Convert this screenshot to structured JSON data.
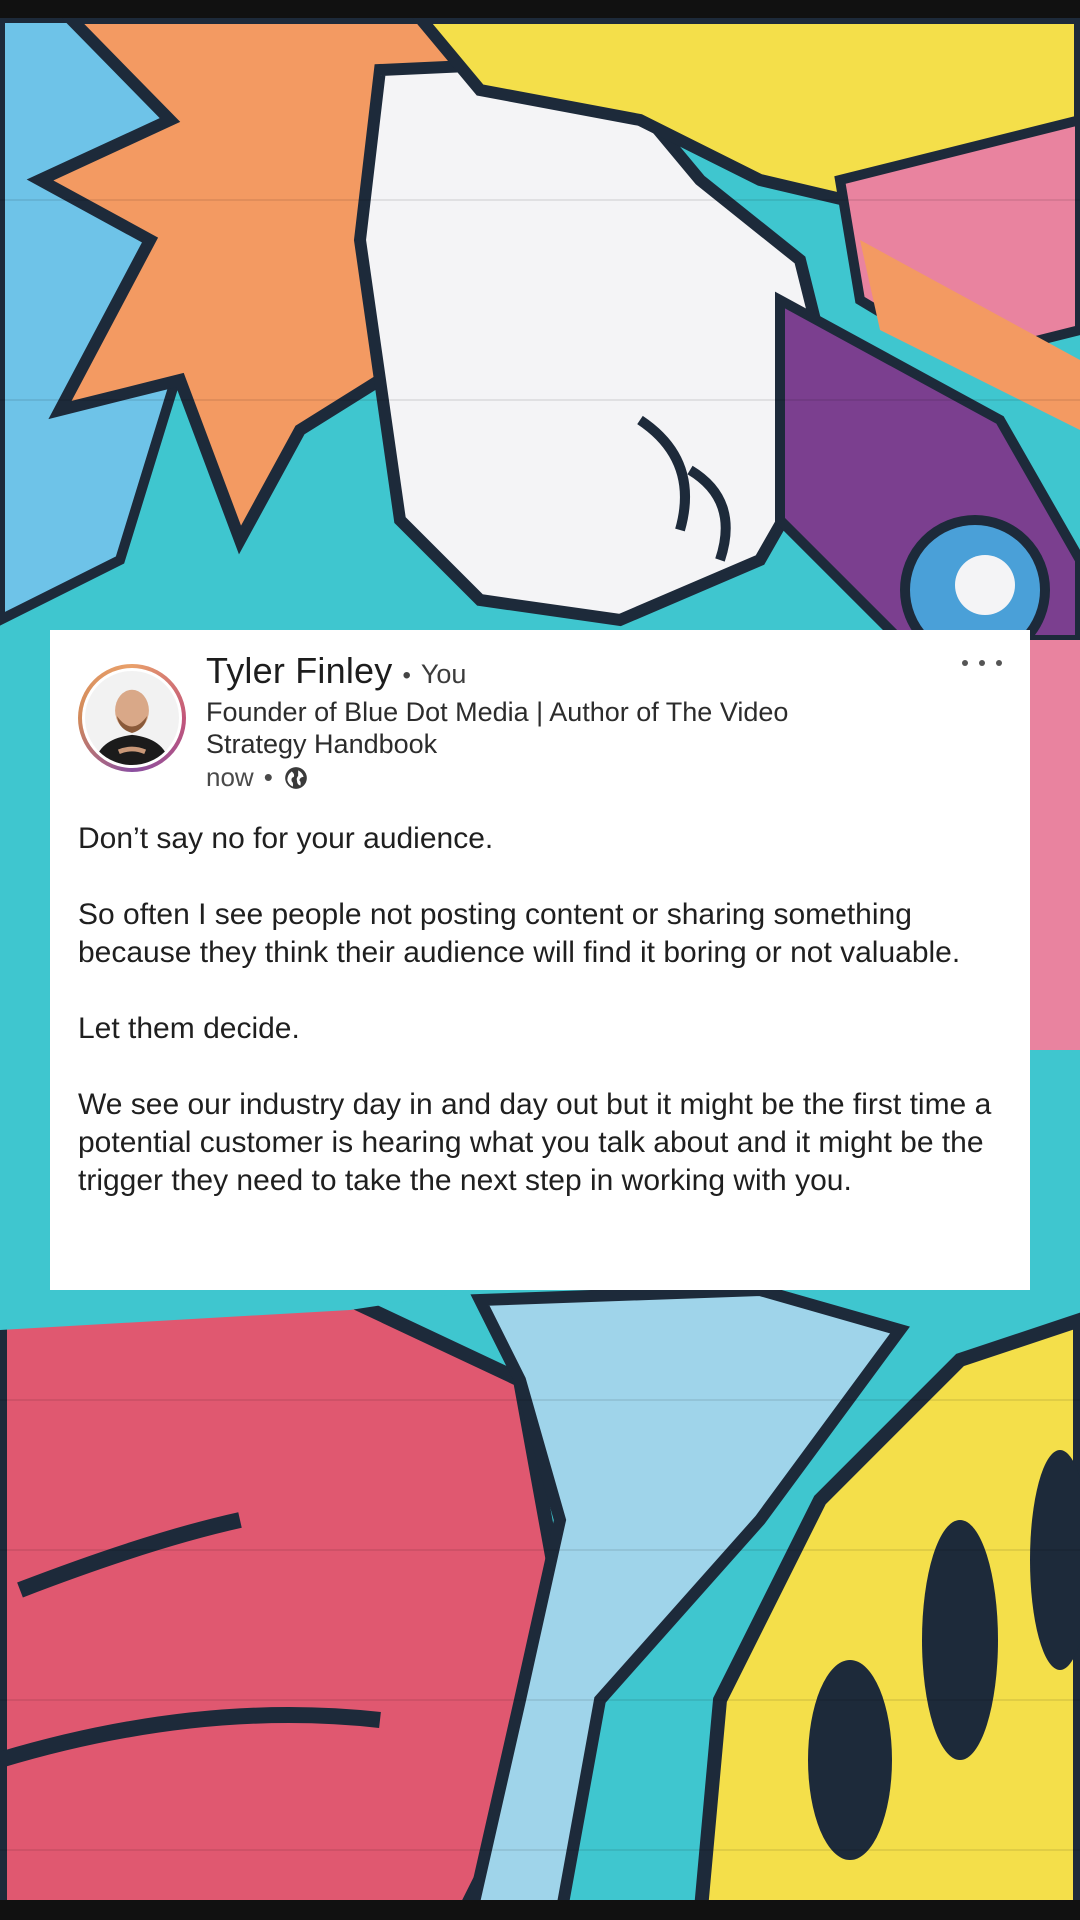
{
  "post": {
    "author": {
      "name": "Tyler Finley",
      "separator": "•",
      "relation": "You",
      "headline": "Founder of Blue Dot Media | Author of The Video Strategy Handbook",
      "time": "now",
      "time_separator": "•",
      "visibility_icon": "globe-icon"
    },
    "more_icon": "more-horizontal-icon",
    "body": [
      "Don’t say no for your audience.",
      "So often I see people not posting content or sharing something because they think their audience will find it boring or not valuable.",
      "Let them decide.",
      "We see our industry day in and day out but it might be the first time a potential customer is hearing what you talk about and it might be the trigger they need to take the next step in working with you."
    ]
  },
  "colors": {
    "card_background": "#ffffff",
    "text_primary": "#1f1f1f",
    "text_secondary": "#4a4a4a",
    "mural_teal": "#3fc6cf",
    "mural_orange": "#f39a62",
    "mural_yellow": "#f4df4a",
    "mural_pink": "#e05870",
    "mural_purple": "#7b3f8f",
    "mural_light_blue": "#9fd4ea"
  }
}
